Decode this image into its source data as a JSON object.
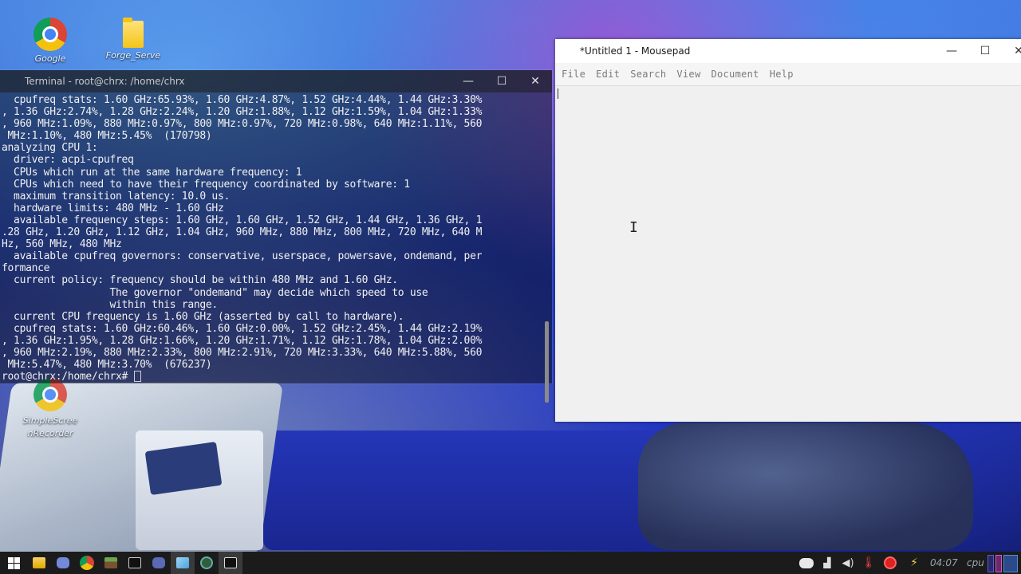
{
  "desktop": {
    "icons": [
      {
        "label": "Google",
        "icon": "chrome-icon"
      },
      {
        "label": "Forge_Serve",
        "icon": "folder-icon"
      },
      {
        "label": "SimpleScree\nnRecorder",
        "icon": "chrome-icon"
      }
    ]
  },
  "terminal": {
    "title": "Terminal - root@chrx: /home/chrx",
    "lines": [
      "  cpufreq stats: 1.60 GHz:65.93%, 1.60 GHz:4.87%, 1.52 GHz:4.44%, 1.44 GHz:3.30%",
      ", 1.36 GHz:2.74%, 1.28 GHz:2.24%, 1.20 GHz:1.88%, 1.12 GHz:1.59%, 1.04 GHz:1.33%",
      ", 960 MHz:1.09%, 880 MHz:0.97%, 800 MHz:0.97%, 720 MHz:0.98%, 640 MHz:1.11%, 560",
      " MHz:1.10%, 480 MHz:5.45%  (170798)",
      "analyzing CPU 1:",
      "  driver: acpi-cpufreq",
      "  CPUs which run at the same hardware frequency: 1",
      "  CPUs which need to have their frequency coordinated by software: 1",
      "  maximum transition latency: 10.0 us.",
      "  hardware limits: 480 MHz - 1.60 GHz",
      "  available frequency steps: 1.60 GHz, 1.60 GHz, 1.52 GHz, 1.44 GHz, 1.36 GHz, 1",
      ".28 GHz, 1.20 GHz, 1.12 GHz, 1.04 GHz, 960 MHz, 880 MHz, 800 MHz, 720 MHz, 640 M",
      "Hz, 560 MHz, 480 MHz",
      "  available cpufreq governors: conservative, userspace, powersave, ondemand, per",
      "formance",
      "  current policy: frequency should be within 480 MHz and 1.60 GHz.",
      "                  The governor \"ondemand\" may decide which speed to use",
      "                  within this range.",
      "  current CPU frequency is 1.60 GHz (asserted by call to hardware).",
      "  cpufreq stats: 1.60 GHz:60.46%, 1.60 GHz:0.00%, 1.52 GHz:2.45%, 1.44 GHz:2.19%",
      ", 1.36 GHz:1.95%, 1.28 GHz:1.66%, 1.20 GHz:1.71%, 1.12 GHz:1.78%, 1.04 GHz:2.00%",
      ", 960 MHz:2.19%, 880 MHz:2.33%, 800 MHz:2.91%, 720 MHz:3.33%, 640 MHz:5.88%, 560",
      " MHz:5.47%, 480 MHz:3.70%  (676237)"
    ],
    "prompt": "root@chrx:/home/chrx# "
  },
  "mousepad": {
    "title": "*Untitled 1 - Mousepad",
    "menu": [
      "File",
      "Edit",
      "Search",
      "View",
      "Document",
      "Help"
    ],
    "content": ""
  },
  "window_buttons": {
    "minimize": "—",
    "maximize": "☐",
    "close": "✕"
  },
  "taskbar": {
    "clock": "04:07",
    "tray_label": "cpu"
  }
}
